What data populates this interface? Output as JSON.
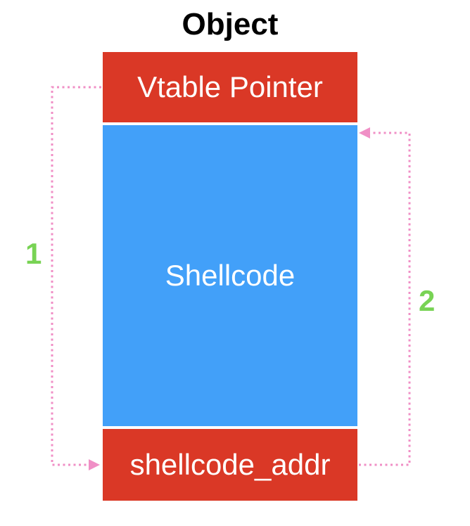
{
  "title": "Object",
  "blocks": {
    "vtable_pointer": "Vtable Pointer",
    "shellcode": "Shellcode",
    "shellcode_addr": "shellcode_addr"
  },
  "steps": {
    "step1": "1",
    "step2": "2"
  },
  "colors": {
    "header_block": "#da3826",
    "body_block": "#42a0f9",
    "arrow": "#f08fc6",
    "step_label": "#78d354",
    "title": "#000000"
  }
}
